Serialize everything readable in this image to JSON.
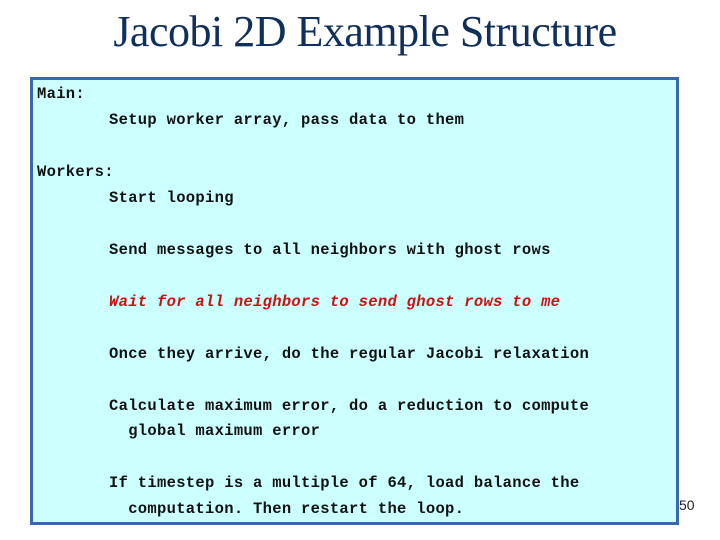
{
  "slide": {
    "title": "Jacobi 2D Example Structure",
    "page_number": "50"
  },
  "content": {
    "main_heading": "Main:",
    "main_steps": [
      "Setup worker array, pass data to them"
    ],
    "workers_heading": "Workers:",
    "worker_steps": [
      "Start looping",
      "Send messages to all neighbors with ghost rows",
      "Wait for all neighbors to send ghost rows to me",
      "Once they arrive, do the regular Jacobi relaxation",
      "Calculate maximum error, do a reduction to compute",
      "  global maximum error",
      "If timestep is a multiple of 64, load balance the",
      "  computation. Then restart the loop."
    ],
    "highlight_color": "#cc1111"
  }
}
